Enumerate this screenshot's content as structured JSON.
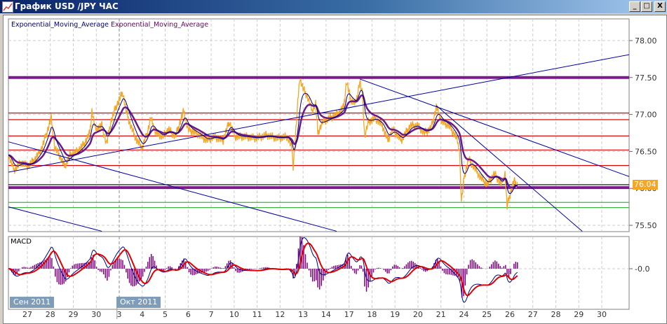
{
  "window": {
    "title": "График USD /JPY  ЧАС",
    "buttons": {
      "minimize": "_",
      "maximize": "□",
      "close": "X"
    }
  },
  "legend": {
    "ema1": "Exponential_Moving_Average",
    "ema2": "Exponential_Moving_Average"
  },
  "macd": {
    "label": "MACD",
    "zero_label": "-0.0"
  },
  "last_price": "76.04",
  "months": [
    "Сен 2011",
    "Окт 2011"
  ],
  "colors": {
    "price": "#f5a623",
    "ema_fast": "#000080",
    "ema_slow": "#6a1a8a",
    "support_thick": "#7b1a8a",
    "level": "#e00000",
    "green": "#40b040",
    "trend": "#0000a0",
    "macd_signal": "#e00000",
    "macd_hist": "#800080"
  },
  "chart_data": {
    "type": "line",
    "title": "USD/JPY hourly",
    "x_tick_labels": [
      "27",
      "28",
      "29",
      "30",
      "3",
      "4",
      "5",
      "6",
      "7",
      "10",
      "11",
      "12",
      "13",
      "14",
      "17",
      "18",
      "19",
      "20",
      "21",
      "24",
      "25",
      "26",
      "27",
      "28",
      "29",
      "30"
    ],
    "y_tick_labels": [
      "78.00",
      "77.50",
      "77.00",
      "76.50",
      "76.00",
      "75.50"
    ],
    "y_ticks": [
      78.0,
      77.5,
      77.0,
      76.5,
      76.0,
      75.5
    ],
    "ylim": [
      75.42,
      78.3
    ],
    "price": [
      [
        -0.82,
        76.45
      ],
      [
        -0.58,
        76.25
      ],
      [
        -0.27,
        76.35
      ],
      [
        0.03,
        76.3
      ],
      [
        0.34,
        76.4
      ],
      [
        0.64,
        76.55
      ],
      [
        0.89,
        76.8
      ],
      [
        1.04,
        76.95
      ],
      [
        1.19,
        76.55
      ],
      [
        1.4,
        76.45
      ],
      [
        1.62,
        76.3
      ],
      [
        1.86,
        76.45
      ],
      [
        2.17,
        76.5
      ],
      [
        2.47,
        76.6
      ],
      [
        2.72,
        76.75
      ],
      [
        2.81,
        77.05
      ],
      [
        2.96,
        76.8
      ],
      [
        3.24,
        76.85
      ],
      [
        3.45,
        76.6
      ],
      [
        3.63,
        76.9
      ],
      [
        3.85,
        77.1
      ],
      [
        4.0,
        77.2
      ],
      [
        4.15,
        77.3
      ],
      [
        4.3,
        77.05
      ],
      [
        4.49,
        76.85
      ],
      [
        4.76,
        76.65
      ],
      [
        5.0,
        76.55
      ],
      [
        5.22,
        76.75
      ],
      [
        5.37,
        76.95
      ],
      [
        5.59,
        76.75
      ],
      [
        5.89,
        76.7
      ],
      [
        6.14,
        76.8
      ],
      [
        6.44,
        76.7
      ],
      [
        6.81,
        77.05
      ],
      [
        6.99,
        76.8
      ],
      [
        7.36,
        76.75
      ],
      [
        7.81,
        76.65
      ],
      [
        8.12,
        76.7
      ],
      [
        8.52,
        76.65
      ],
      [
        8.79,
        76.9
      ],
      [
        9.04,
        76.7
      ],
      [
        9.49,
        76.7
      ],
      [
        9.95,
        76.68
      ],
      [
        10.41,
        76.72
      ],
      [
        10.87,
        76.68
      ],
      [
        11.32,
        76.7
      ],
      [
        11.51,
        76.55
      ],
      [
        11.57,
        76.3
      ],
      [
        11.69,
        76.8
      ],
      [
        11.85,
        77.5
      ],
      [
        12.0,
        77.35
      ],
      [
        12.18,
        77.25
      ],
      [
        12.39,
        77.05
      ],
      [
        12.55,
        77.15
      ],
      [
        12.64,
        76.75
      ],
      [
        12.85,
        76.9
      ],
      [
        13.16,
        76.95
      ],
      [
        13.46,
        77.0
      ],
      [
        13.77,
        77.1
      ],
      [
        13.89,
        77.45
      ],
      [
        14.07,
        77.2
      ],
      [
        14.29,
        77.15
      ],
      [
        14.47,
        77.45
      ],
      [
        14.59,
        77.25
      ],
      [
        14.68,
        76.7
      ],
      [
        14.84,
        76.9
      ],
      [
        15.14,
        76.95
      ],
      [
        15.45,
        76.85
      ],
      [
        15.69,
        76.65
      ],
      [
        15.9,
        76.8
      ],
      [
        16.27,
        76.65
      ],
      [
        16.67,
        76.85
      ],
      [
        16.97,
        76.85
      ],
      [
        17.28,
        76.75
      ],
      [
        17.58,
        76.82
      ],
      [
        17.8,
        77.1
      ],
      [
        18.04,
        76.9
      ],
      [
        18.35,
        76.85
      ],
      [
        18.65,
        76.7
      ],
      [
        18.8,
        76.55
      ],
      [
        18.86,
        76.1
      ],
      [
        18.89,
        75.82
      ],
      [
        19.01,
        76.15
      ],
      [
        19.2,
        76.4
      ],
      [
        19.41,
        76.3
      ],
      [
        19.72,
        76.15
      ],
      [
        20.02,
        76.05
      ],
      [
        20.33,
        76.2
      ],
      [
        20.63,
        76.05
      ],
      [
        20.79,
        76.2
      ],
      [
        20.88,
        75.75
      ],
      [
        21.03,
        75.95
      ],
      [
        21.18,
        76.1
      ],
      [
        21.33,
        76.05
      ]
    ],
    "horizontal_levels": [
      {
        "price": 77.5,
        "kind": "support_thick"
      },
      {
        "price": 77.02,
        "kind": "level"
      },
      {
        "price": 76.93,
        "kind": "level"
      },
      {
        "price": 76.71,
        "kind": "level"
      },
      {
        "price": 76.52,
        "kind": "level"
      },
      {
        "price": 76.31,
        "kind": "level"
      },
      {
        "price": 76.05,
        "kind": "black"
      },
      {
        "price": 76.01,
        "kind": "support_thick"
      },
      {
        "price": 75.81,
        "kind": "green"
      },
      {
        "price": 75.74,
        "kind": "green"
      }
    ],
    "trend_lines": [
      [
        [
          -0.82,
          76.22
        ],
        [
          26.19,
          77.81
        ]
      ],
      [
        [
          -0.82,
          76.63
        ],
        [
          13.46,
          75.42
        ]
      ],
      [
        [
          -0.82,
          75.75
        ],
        [
          3.24,
          75.42
        ]
      ],
      [
        [
          14.47,
          77.48
        ],
        [
          26.19,
          76.16
        ]
      ],
      [
        [
          17.8,
          77.12
        ],
        [
          24.15,
          75.42
        ]
      ]
    ]
  }
}
